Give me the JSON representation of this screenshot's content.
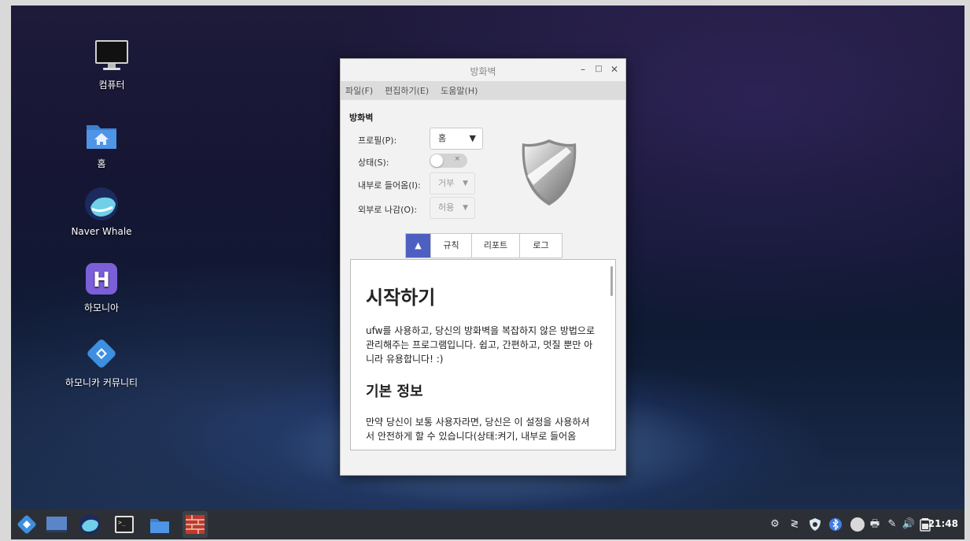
{
  "desktop": {
    "icons": [
      {
        "name": "computer",
        "label": "컴퓨터"
      },
      {
        "name": "home",
        "label": "홈"
      },
      {
        "name": "naver-whale",
        "label": "Naver Whale"
      },
      {
        "name": "harmonia",
        "label": "하모니아"
      },
      {
        "name": "hamonikr-community",
        "label": "하모니카 커뮤니티"
      }
    ]
  },
  "window": {
    "title": "방화벽",
    "controls": {
      "minimize": "–",
      "maximize": "□",
      "close": "✕"
    },
    "menu": [
      "파일(F)",
      "편집하기(E)",
      "도움말(H)"
    ],
    "section_title": "방화벽",
    "profile": {
      "label": "프로필(P):",
      "value": "홈"
    },
    "status": {
      "label": "상태(S):",
      "on": false,
      "off_symbol": "×"
    },
    "incoming": {
      "label": "내부로 들어옴(I):",
      "value": "거부"
    },
    "outgoing": {
      "label": "외부로 나감(O):",
      "value": "허용"
    },
    "tabs": [
      {
        "label": "",
        "icon": "home-icon",
        "active": true
      },
      {
        "label": "규칙",
        "active": false
      },
      {
        "label": "리포트",
        "active": false
      },
      {
        "label": "로그",
        "active": false
      }
    ],
    "content": {
      "heading1": "시작하기",
      "para1": "ufw를 사용하고, 당신의 방화벽을 복잡하지 않은 방법으로 관리해주는 프로그램입니다. 쉽고, 간편하고, 멋질 뿐만 아니라 유용합니다! :)",
      "heading2": "기본 정보",
      "para2": "만약 당신이 보통 사용자라면, 당신은 이 설정을 사용하셔서 안전하게 할 수 있습니다(상태:켜기, 내부로 들어옴"
    }
  },
  "taskbar": {
    "apps": [
      "start-menu-icon",
      "desktop-icon",
      "whale-icon",
      "terminal-icon",
      "files-icon",
      "firewall-icon"
    ],
    "tray": [
      "steam-icon",
      "updates-icon",
      "shield-icon",
      "bluetooth-icon",
      "user-icon",
      "printer-icon",
      "pen-icon",
      "volume-icon",
      "battery-icon"
    ],
    "clock": "21:48"
  },
  "colors": {
    "accent": "#4e5fc2",
    "taskbar": "#2c3036"
  }
}
